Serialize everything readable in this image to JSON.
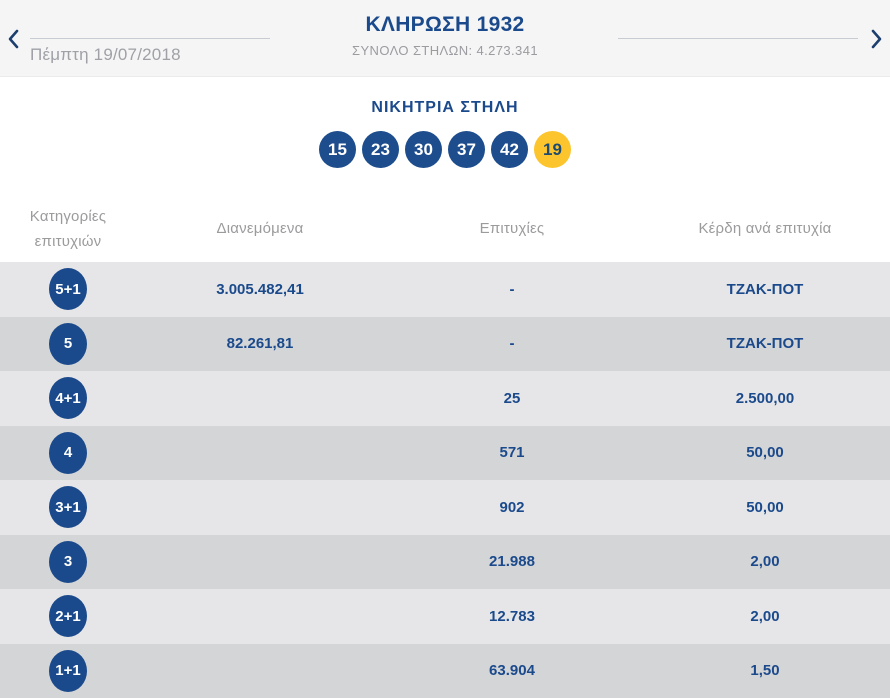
{
  "header": {
    "title": "ΚΛΗΡΩΣΗ 1932",
    "subtitle": "ΣΥΝΟΛΟ ΣΤΗΛΩΝ: 4.273.341",
    "date": "Πέμπτη 19/07/2018"
  },
  "winning": {
    "title": "ΝΙΚΗΤΡΙΑ ΣΤΗΛΗ",
    "numbers": [
      "15",
      "23",
      "30",
      "37",
      "42"
    ],
    "joker": "19"
  },
  "table": {
    "columns": [
      "Κατηγορίες επιτυχιών",
      "Διανεμόμενα",
      "Επιτυχίες",
      "Κέρδη ανά επιτυχία"
    ],
    "rows": [
      {
        "category": "5+1",
        "distributed": "3.005.482,41",
        "wins": "-",
        "prize": "ΤΖΑΚ-ΠΟΤ"
      },
      {
        "category": "5",
        "distributed": "82.261,81",
        "wins": "-",
        "prize": "ΤΖΑΚ-ΠΟΤ"
      },
      {
        "category": "4+1",
        "distributed": "",
        "wins": "25",
        "prize": "2.500,00"
      },
      {
        "category": "4",
        "distributed": "",
        "wins": "571",
        "prize": "50,00"
      },
      {
        "category": "3+1",
        "distributed": "",
        "wins": "902",
        "prize": "50,00"
      },
      {
        "category": "3",
        "distributed": "",
        "wins": "21.988",
        "prize": "2,00"
      },
      {
        "category": "2+1",
        "distributed": "",
        "wins": "12.783",
        "prize": "2,00"
      },
      {
        "category": "1+1",
        "distributed": "",
        "wins": "63.904",
        "prize": "1,50"
      }
    ]
  },
  "colors": {
    "navy": "#1b4a8c",
    "joker_yellow": "#fcc52e",
    "row_light": "#e6e6e8",
    "row_dark": "#d4d5d7",
    "muted_text": "#9b9ba0",
    "header_band": "#f5f5f6"
  }
}
